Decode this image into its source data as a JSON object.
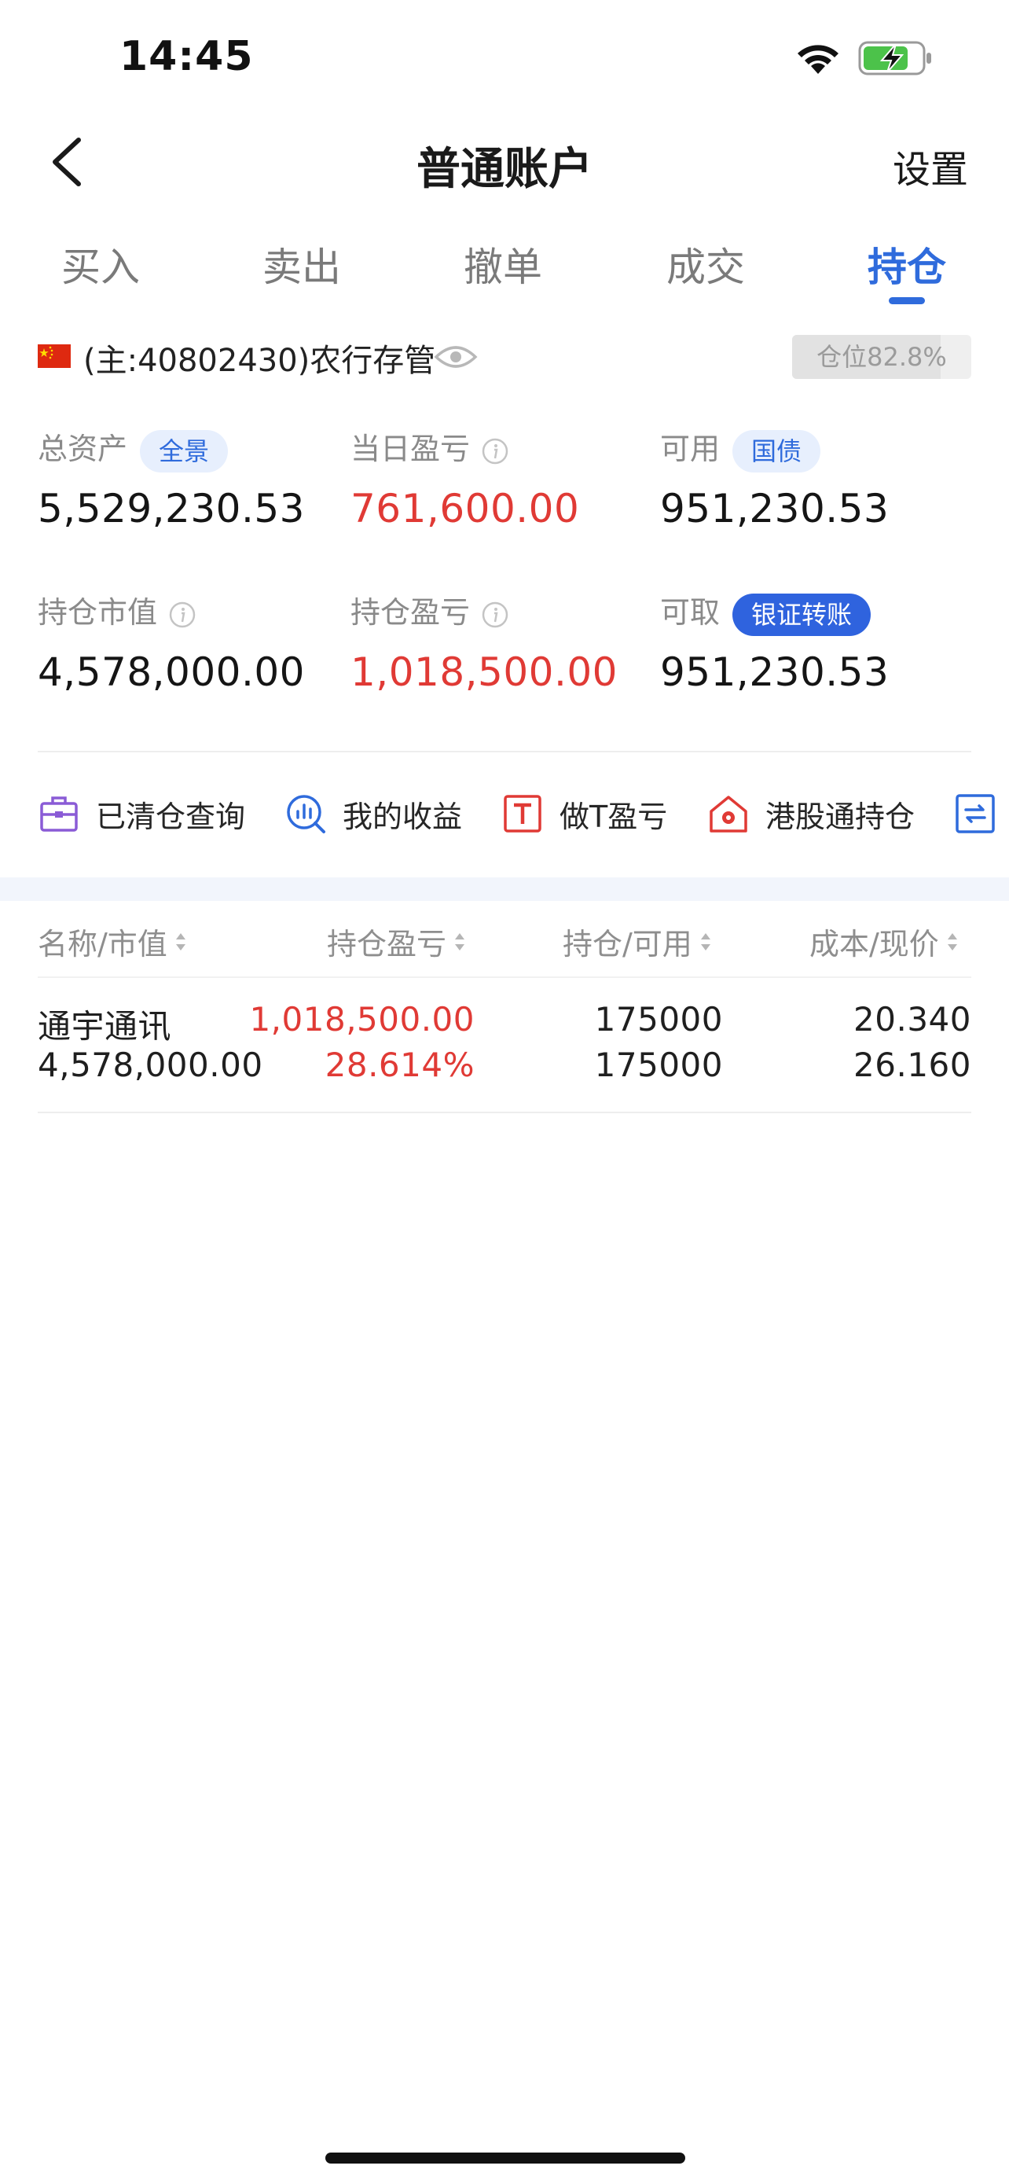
{
  "status_bar": {
    "time": "14:45",
    "icons": [
      "wifi-icon",
      "battery-charging-icon"
    ]
  },
  "nav": {
    "back_icon": "chevron-left-icon",
    "title": "普通账户",
    "settings_label": "设置"
  },
  "tabs": [
    {
      "label": "买入",
      "active": false
    },
    {
      "label": "卖出",
      "active": false
    },
    {
      "label": "撤单",
      "active": false
    },
    {
      "label": "成交",
      "active": false
    },
    {
      "label": "持仓",
      "active": true
    }
  ],
  "account": {
    "flag_icon": "china-flag-icon",
    "label": "(主:40802430)农行存管",
    "visibility_icon": "eye-icon",
    "position_label": "仓位82.8%",
    "position_ratio": 0.828
  },
  "summary": {
    "total_assets": {
      "label": "总资产",
      "tag": "全景",
      "value": "5,529,230.53"
    },
    "daily_pnl": {
      "label": "当日盈亏",
      "value": "761,600.00"
    },
    "available": {
      "label": "可用",
      "tag": "国债",
      "value": "951,230.53"
    },
    "market_value": {
      "label": "持仓市值",
      "value": "4,578,000.00"
    },
    "position_pnl": {
      "label": "持仓盈亏",
      "value": "1,018,500.00"
    },
    "withdrawable": {
      "label": "可取",
      "tag": "银证转账",
      "value": "951,230.53"
    }
  },
  "quick_actions": [
    {
      "label": "已清仓查询",
      "icon": "briefcase-icon"
    },
    {
      "label": "我的收益",
      "icon": "chart-magnifier-icon"
    },
    {
      "label": "做T盈亏",
      "icon": "t-box-icon"
    },
    {
      "label": "港股通持仓",
      "icon": "hk-house-icon"
    },
    {
      "label": "",
      "icon": "exchange-icon"
    }
  ],
  "table": {
    "headers": [
      "名称/市值",
      "持仓盈亏",
      "持仓/可用",
      "成本/现价"
    ],
    "rows": [
      {
        "name": "通宇通讯",
        "market_value": "4,578,000.00",
        "pnl": "1,018,500.00",
        "pnl_pct": "28.614%",
        "holding": "175000",
        "available": "175000",
        "cost": "20.340",
        "price": "26.160"
      }
    ]
  },
  "colors": {
    "accent": "#2f6bdc",
    "loss_gain_red": "#e03a35",
    "muted": "#8a8a8a"
  }
}
